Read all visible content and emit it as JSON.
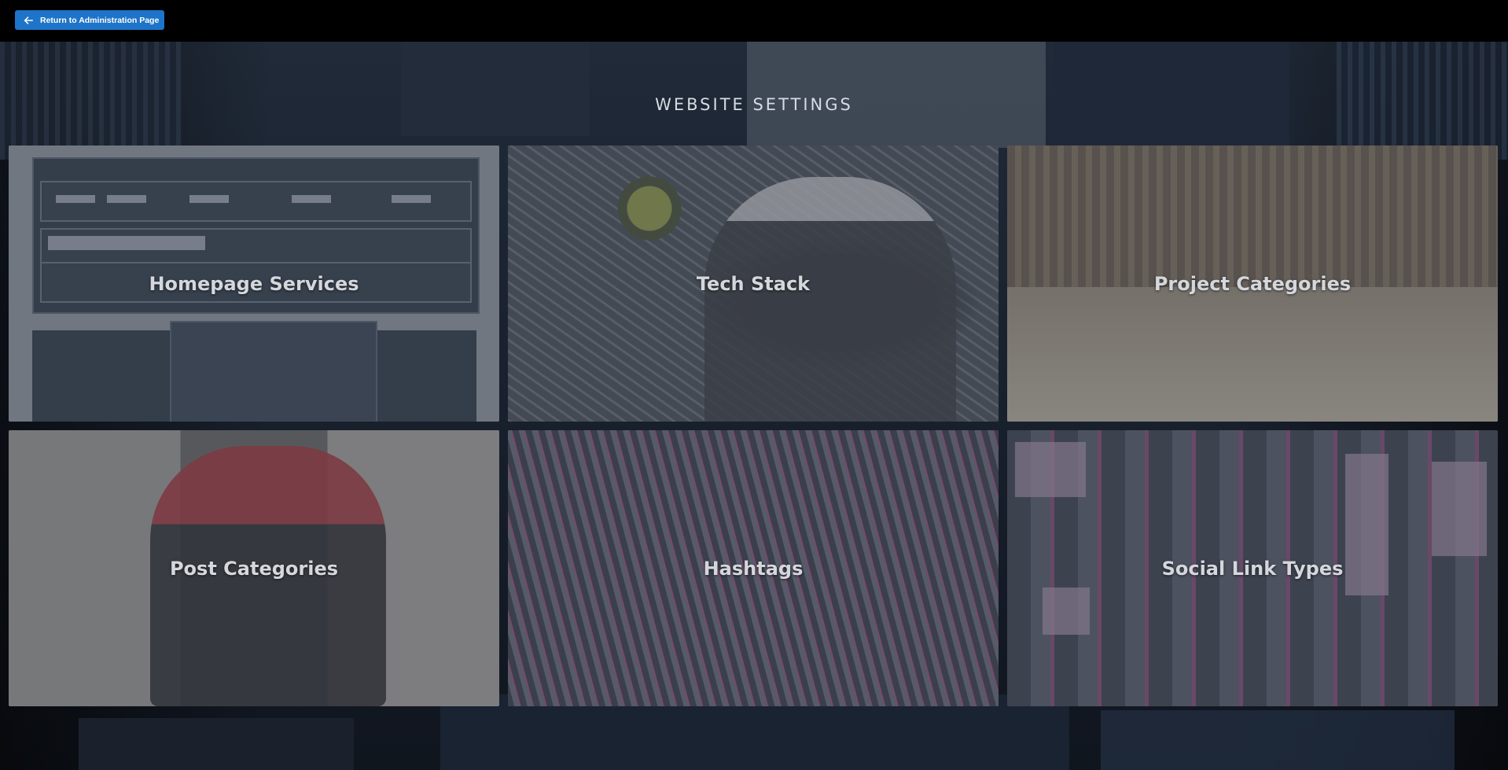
{
  "topbar": {
    "return_button_label": "Return to Administration Page",
    "return_icon": "arrow-left-icon"
  },
  "page": {
    "title": "WEBSITE SETTINGS"
  },
  "cards": [
    {
      "label": "Homepage Services"
    },
    {
      "label": "Tech Stack"
    },
    {
      "label": "Project Categories"
    },
    {
      "label": "Post Categories"
    },
    {
      "label": "Hashtags"
    },
    {
      "label": "Social Link Types"
    }
  ],
  "colors": {
    "accent": "#1e74c8",
    "topbar_bg": "#000000",
    "title_text": "#d6dbe3",
    "card_label": "#d4d7dc"
  }
}
